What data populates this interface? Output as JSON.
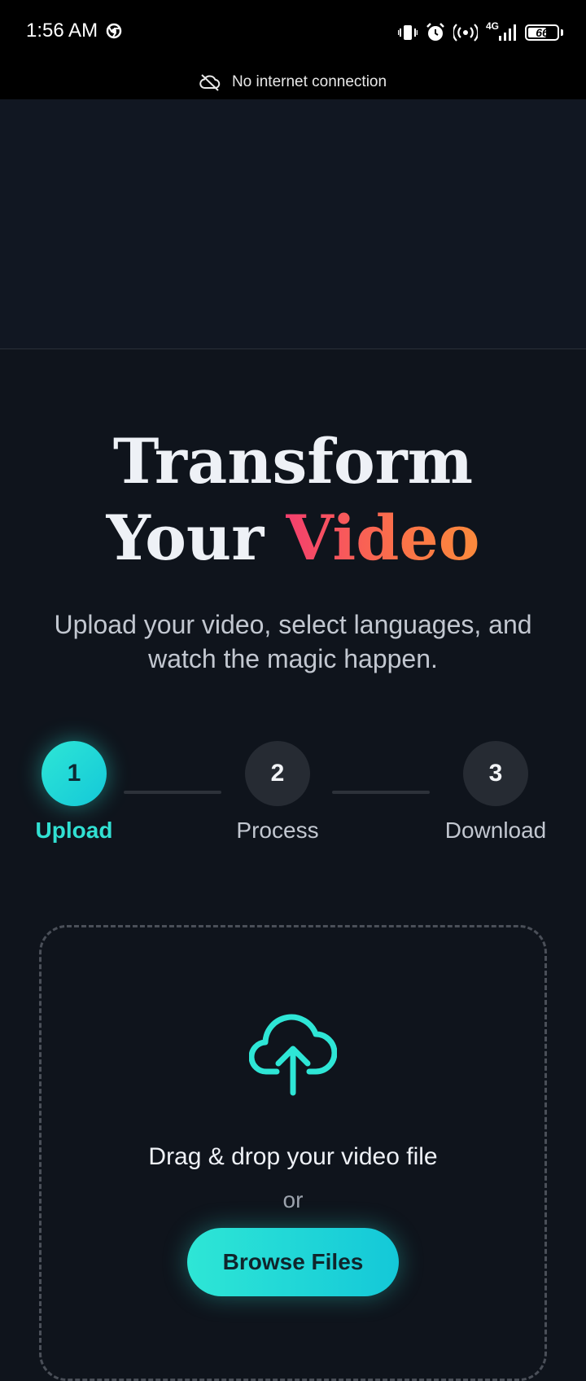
{
  "status_bar": {
    "time": "1:56 AM",
    "network": "4G",
    "battery": "66",
    "battery_level_percent": 66,
    "icons": [
      "chrome-icon",
      "vibrate-icon",
      "alarm-icon",
      "hotspot-icon",
      "signal-icon",
      "battery-icon"
    ]
  },
  "offline_banner": {
    "icon": "cloud-off-icon",
    "text": "No internet connection"
  },
  "hero": {
    "title_line1": "Transform",
    "title_line2_plain": "Your",
    "title_line2_accent": "Video",
    "subtitle": "Upload your video, select languages, and watch the magic happen."
  },
  "steps": [
    {
      "number": "1",
      "label": "Upload",
      "active": true
    },
    {
      "number": "2",
      "label": "Process",
      "active": false
    },
    {
      "number": "3",
      "label": "Download",
      "active": false
    }
  ],
  "upload": {
    "icon": "cloud-upload-icon",
    "drop_text": "Drag & drop your video file",
    "or_text": "or",
    "browse_label": "Browse Files"
  },
  "colors": {
    "accent_teal": "#2ee6d6",
    "accent_pink": "#f43f6e",
    "accent_orange": "#fb8a3c",
    "background": "#0f141c"
  }
}
